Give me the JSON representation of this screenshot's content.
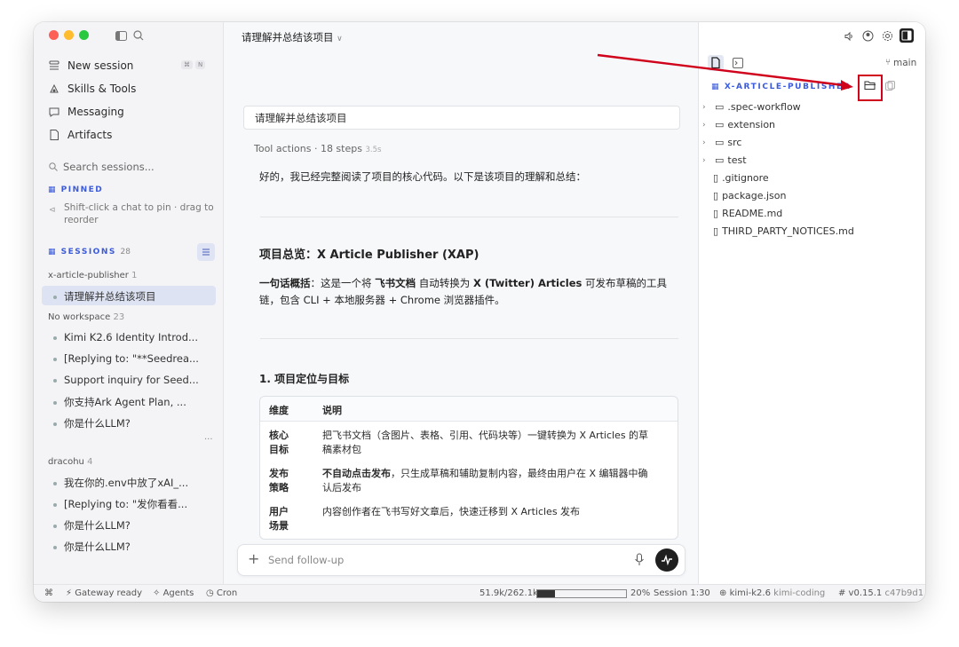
{
  "window": {
    "title_dropdown": "请理解并总结该项目",
    "traffic_colors": [
      "#fe5f57",
      "#febc2e",
      "#28c840"
    ]
  },
  "sidebar": {
    "nav": [
      {
        "label": "New session",
        "icon": "new-session-icon",
        "shortcut": [
          "⌘",
          "N"
        ]
      },
      {
        "label": "Skills & Tools",
        "icon": "skills-icon"
      },
      {
        "label": "Messaging",
        "icon": "message-icon"
      },
      {
        "label": "Artifacts",
        "icon": "artifacts-icon"
      }
    ],
    "search_placeholder": "Search sessions...",
    "pinned_label": "PINNED",
    "pinned_hint": "Shift-click a chat to pin · drag to reorder",
    "sessions_label": "SESSIONS",
    "sessions_count": "28",
    "groups": [
      {
        "name": "x-article-publisher",
        "count": "1",
        "items": [
          "请理解并总结该项目"
        ]
      },
      {
        "name": "No workspace",
        "count": "23",
        "items": [
          "Kimi K2.6 Identity Introd...",
          "[Replying to: \"**Seedrea...",
          "Support inquiry for Seed...",
          "你支持Ark Agent Plan, ...",
          "你是什么LLM?"
        ],
        "more": "..."
      },
      {
        "name": "dracohu",
        "count": "4",
        "items": [
          "我在你的.env中放了xAI_...",
          "[Replying to: \"发你看看...",
          "你是什么LLM?",
          "你是什么LLM?"
        ]
      }
    ]
  },
  "main": {
    "user_message": "请理解并总结该项目",
    "tool_actions": "Tool actions · 18 steps",
    "tool_time": "3.5s",
    "reply_intro": "好的，我已经完整阅读了项目的核心代码。以下是该项目的理解和总结：",
    "overview_title": "项目总览：X Article Publisher (XAP)",
    "summary_label": "一句话概括",
    "summary_p1": "：这是一个将 ",
    "summary_b1": "飞书文档",
    "summary_p2": " 自动转换为 ",
    "summary_b2": "X (Twitter) Articles",
    "summary_p3": " 可发布草稿的工具",
    "summary_line2": "链，包含 CLI + 本地服务器 + Chrome 浏览器插件。",
    "section1_title": "1. 项目定位与目标",
    "table": {
      "headers": [
        "维度",
        "说明"
      ],
      "rows": [
        {
          "k1": "核心",
          "k2": "目标",
          "v1": "把飞书文档（含图片、表格、引用、代码块等）一键转换为 X Articles 的草",
          "v2": "稿素材包"
        },
        {
          "k1": "发布",
          "k2": "策略",
          "vb": "不自动点击发布",
          "v1": "，只生成草稿和辅助复制内容，最终由用户在 X 编辑器中确",
          "v2": "认后发布"
        },
        {
          "k1": "用户",
          "k2": "场景",
          "v1": "内容创作者在飞书写好文章后，快速迁移到 X Articles 发布",
          "v2": ""
        }
      ]
    },
    "input_placeholder": "Send follow-up"
  },
  "right_panel": {
    "branch": "main",
    "project_name": "X-ARTICLE-PUBLISHER",
    "tree": [
      {
        "name": ".spec-workflow",
        "type": "folder"
      },
      {
        "name": "extension",
        "type": "folder"
      },
      {
        "name": "src",
        "type": "folder"
      },
      {
        "name": "test",
        "type": "folder"
      },
      {
        "name": ".gitignore",
        "type": "file"
      },
      {
        "name": "package.json",
        "type": "file"
      },
      {
        "name": "README.md",
        "type": "file"
      },
      {
        "name": "THIRD_PARTY_NOTICES.md",
        "type": "file"
      }
    ],
    "annotation_color": "#d0021b"
  },
  "status_bar": {
    "gateway": "Gateway ready",
    "agents": "Agents",
    "cron": "Cron",
    "tokens": "51.9k/262.1k",
    "percent": "20%",
    "usage_fraction": 0.2,
    "session": "Session 1:30",
    "model": "kimi-k2.6",
    "provider": "kimi-coding",
    "version": "# v0.15.1",
    "commit": "c47b9d1"
  }
}
